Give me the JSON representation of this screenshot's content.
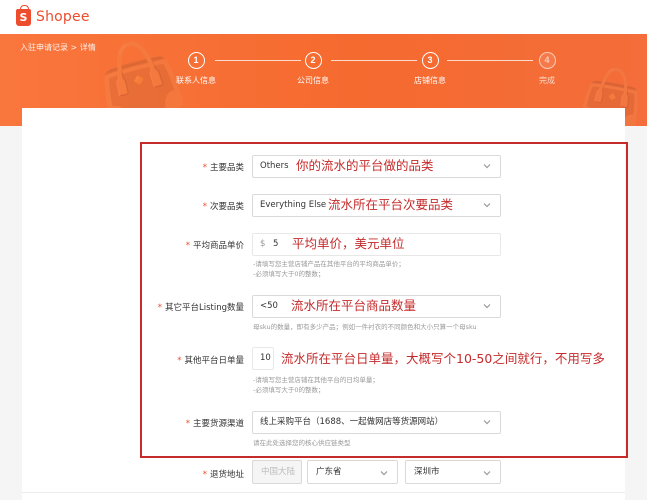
{
  "app": {
    "logo_text": "Shopee",
    "logo_glyph": "S",
    "brand_color": "#ee4d2d"
  },
  "breadcrumb": "入驻申请记录 > 详情",
  "steps": [
    {
      "number": "1",
      "label": "联系人信息"
    },
    {
      "number": "2",
      "label": "公司信息"
    },
    {
      "number": "3",
      "label": "店铺信息"
    },
    {
      "number": "4",
      "label": "完成"
    }
  ],
  "form": {
    "main_category": {
      "label": "主要品类",
      "value": "Others",
      "annotation": "你的流水的平台做的品类"
    },
    "secondary_category": {
      "label": "次要品类",
      "value": "Everything Else",
      "annotation": "流水所在平台次要品类"
    },
    "avg_price": {
      "label": "平均商品单价",
      "currency": "$",
      "value": "5",
      "annotation": "平均单价，美元单位",
      "hints": [
        "-请填写您主营店铺产品在其他平台的平均商品单价；",
        "-必须填写大于0的整数；"
      ]
    },
    "listing_count": {
      "label": "其它平台Listing数量",
      "value": "<50",
      "annotation": "流水所在平台商品数量",
      "hint": "母sku的数量，即有多少产品；例如一件衬衣的不同颜色和大小只算一个母sku"
    },
    "daily_orders": {
      "label": "其他平台日单量",
      "value": "10",
      "annotation": "流水所在平台日单量，大概写个10-50之间就行，不用写多",
      "hints": [
        "-请填写您主营店铺在其他平台的日均单量；",
        "-必须填写大于0的整数；"
      ]
    },
    "supply_channel": {
      "label": "主要货源渠道",
      "value": "线上采购平台（1688、一起做网店等货源网站）",
      "hint": "请在此处选择您的核心供应链类型"
    },
    "return_address": {
      "label": "退货地址",
      "country": "中国大陆",
      "province": "广东省",
      "city": "深圳市"
    }
  },
  "colors": {
    "annotation_red": "#c62b2b",
    "banner_orange": "#f56a2f"
  }
}
